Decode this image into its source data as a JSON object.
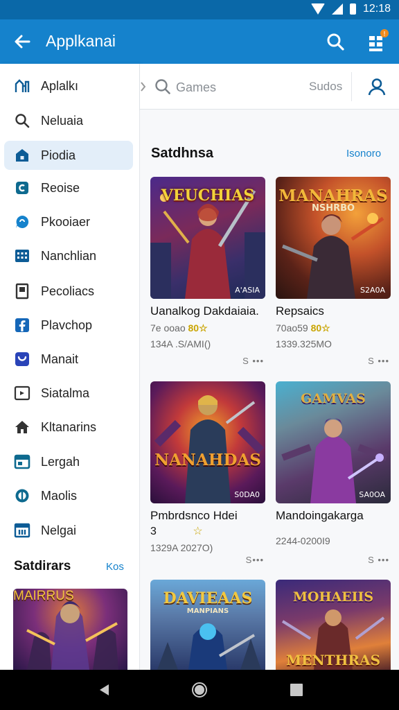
{
  "status_bar": {
    "time": "12:18"
  },
  "app_bar": {
    "title": "Applkanai",
    "icons": [
      "arrow-back-icon",
      "search-icon",
      "apps-menu-icon"
    ]
  },
  "drawer": {
    "items": [
      {
        "label": "Aplalkı",
        "icon": "chart-icon"
      },
      {
        "label": "Neluaia",
        "icon": "search-icon"
      },
      {
        "label": "Piodia",
        "icon": "house-icon",
        "active": true
      },
      {
        "label": "Reoise",
        "icon": "square-badge-icon"
      },
      {
        "label": "Pkooiaer",
        "icon": "chat-icon"
      },
      {
        "label": "Nanchlian",
        "icon": "keypad-icon"
      },
      {
        "label": "Pecoliacs",
        "icon": "document-icon"
      },
      {
        "label": "Plavchop",
        "icon": "facebook-icon"
      },
      {
        "label": "Manait",
        "icon": "shield-icon"
      },
      {
        "label": "Siatalma",
        "icon": "frame-icon"
      },
      {
        "label": "Kltanarins",
        "icon": "house-icon"
      },
      {
        "label": "Lergah",
        "icon": "window-icon"
      },
      {
        "label": "Maolis",
        "icon": "circle-icon"
      },
      {
        "label": "Nelgai",
        "icon": "calendar-icon"
      }
    ],
    "section_title": "Satdirars",
    "section_link": "Kos"
  },
  "search": {
    "placeholder": "Games",
    "filter_label": "Sudos"
  },
  "section": {
    "title": "Satdhnsa",
    "link": "Isonoro"
  },
  "cards": [
    {
      "art_title": "VEUCHIAS",
      "art_corner": "A'ASIA",
      "title": "Uanalkog Dakdaiaia.",
      "meta_prefix": "7e ooao",
      "meta_accent": "80☆",
      "size": "134A .S/AMI()",
      "more": "S ••• "
    },
    {
      "art_title": "MANAHRAS",
      "art_sub": "NSHRBO",
      "art_corner": "S2A0A",
      "title": "Repsaics",
      "meta_prefix": "70ao59",
      "meta_accent": "80☆",
      "size": "1339.325MO",
      "more": "S •••"
    },
    {
      "art_title": "NANAHDAS",
      "art_corner": "S0DA0",
      "title": "Pmbrdsnco Hdei",
      "title_line2": "3",
      "meta_accent": "☆",
      "size": "1329A 2027O)",
      "more": "S•••"
    },
    {
      "art_title": "GAMVAS",
      "art_corner": "SA0OA",
      "title": "Mandoingakarga",
      "size": "2244-0200I9",
      "more": "S •••"
    },
    {
      "art_title": "DAVIEAAS",
      "art_sub": "MANPIANS",
      "title": "",
      "size": ""
    },
    {
      "art_title": "MOHAEIIS",
      "art_sub": "MENTHRAS",
      "title": "",
      "size": ""
    }
  ],
  "drawer_thumb": {
    "art_title": "MAIRRUS"
  },
  "nav_bar": {
    "buttons": [
      "back-triangle-icon",
      "home-circle-icon",
      "recents-square-icon"
    ]
  },
  "colors": {
    "app_bar": "#1582cc",
    "status_bar": "#0a68a8",
    "accent_link": "#1582cc",
    "active_item": "#e3eef9",
    "icon_blue": "#0d5c96"
  }
}
